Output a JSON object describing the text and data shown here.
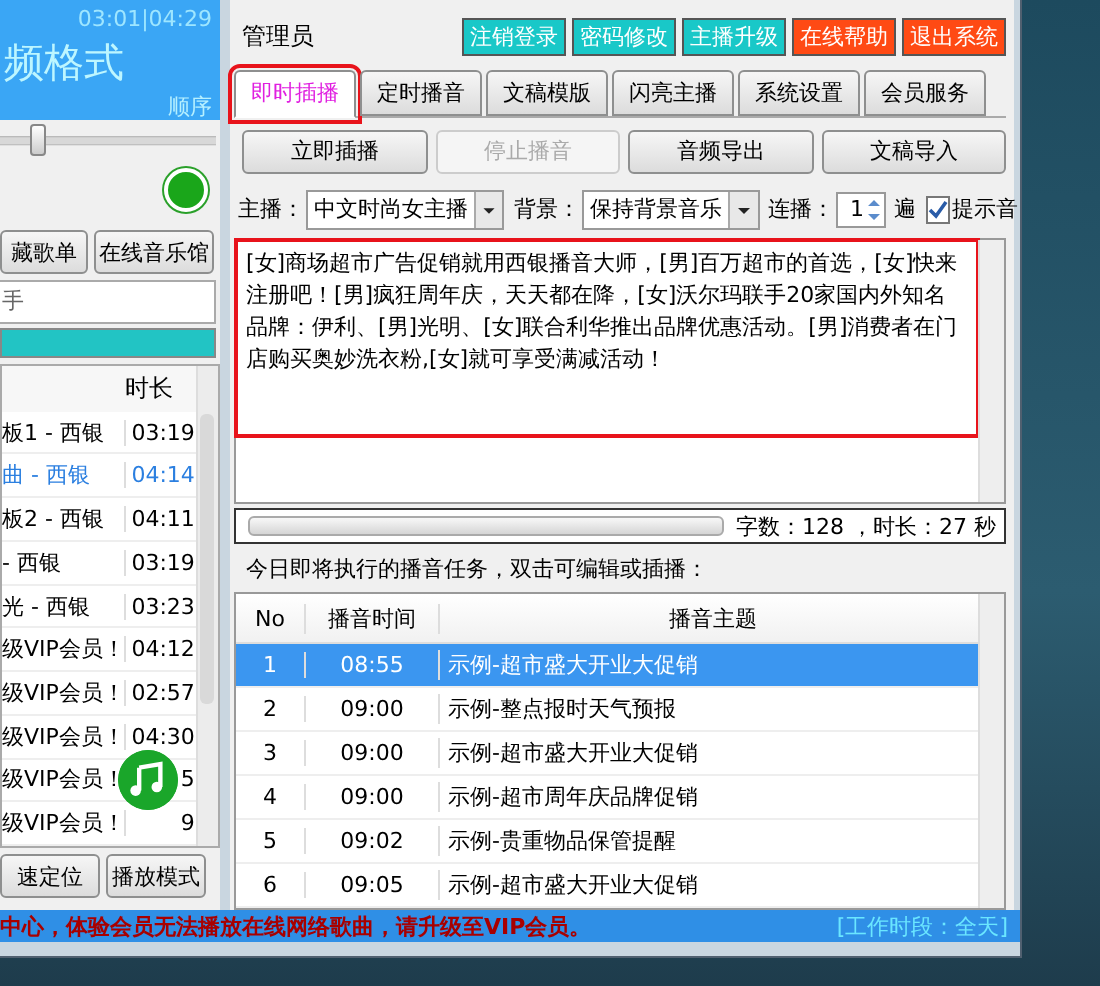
{
  "player": {
    "time": "03:01|04:29",
    "title": "频格式",
    "mode": "顺序",
    "volume": {
      "level": 0.15
    },
    "online": true
  },
  "library_buttons": [
    "藏歌单",
    "在线音乐馆"
  ],
  "search": {
    "value": "手"
  },
  "playlist": {
    "columns": [
      "时长"
    ],
    "rows": [
      {
        "title": "板1 - 西银",
        "duration": "03:19",
        "playing": false
      },
      {
        "title": "曲 - 西银",
        "duration": "04:14",
        "playing": true
      },
      {
        "title": "板2 - 西银",
        "duration": "04:11",
        "playing": false
      },
      {
        "title": "- 西银",
        "duration": "03:19",
        "playing": false
      },
      {
        "title": "光 - 西银",
        "duration": "03:23",
        "playing": false
      },
      {
        "title": "级VIP会员！",
        "duration": "04:12",
        "playing": false
      },
      {
        "title": "级VIP会员！",
        "duration": "02:57",
        "playing": false
      },
      {
        "title": "级VIP会员！",
        "duration": "04:30",
        "playing": false
      },
      {
        "title": "级VIP会员！",
        "duration": "5",
        "playing": false
      },
      {
        "title": "级VIP会员！",
        "duration": "9",
        "playing": false
      }
    ]
  },
  "playlist_buttons": [
    "速定位",
    "播放模式"
  ],
  "user": "管理员",
  "top_buttons": [
    {
      "label": "注销登录",
      "color": "#19c8c8"
    },
    {
      "label": "密码修改",
      "color": "#19c8c8"
    },
    {
      "label": "主播升级",
      "color": "#19c8c8"
    },
    {
      "label": "在线帮助",
      "color": "#ff4a14"
    },
    {
      "label": "退出系统",
      "color": "#ff4a14"
    }
  ],
  "tabs": [
    {
      "label": "即时插播",
      "selected": true,
      "highlighted": true
    },
    {
      "label": "定时播音",
      "selected": false,
      "highlighted": false
    },
    {
      "label": "文稿模版",
      "selected": false,
      "highlighted": false
    },
    {
      "label": "闪亮主播",
      "selected": false,
      "highlighted": false
    },
    {
      "label": "系统设置",
      "selected": false,
      "highlighted": false
    },
    {
      "label": "会员服务",
      "selected": false,
      "highlighted": false
    }
  ],
  "actions": [
    {
      "label": "立即插播",
      "disabled": false
    },
    {
      "label": "停止播音",
      "disabled": true
    },
    {
      "label": "音频导出",
      "disabled": false
    },
    {
      "label": "文稿导入",
      "disabled": false
    }
  ],
  "options": {
    "host_label": "主播：",
    "host": "中文时尚女主播",
    "bg_label": "背景：",
    "bg": "保持背景音乐",
    "repeat_label": "连播：",
    "repeat": "1",
    "repeat_unit": "遍",
    "chime": {
      "label": "提示音",
      "checked": true
    }
  },
  "script": {
    "text": "[女]商场超市广告促销就用西银播音大师，[男]百万超市的首选，[女]快来注册吧！[男]疯狂周年庆，天天都在降，[女]沃尔玛联手20家国内外知名品牌：伊利、[男]光明、[女]联合利华推出品牌优惠活动。[男]消费者在门店购买奥妙洗衣粉,[女]就可享受满减活动！",
    "highlighted": true
  },
  "stats": "字数：128 ，时长：27 秒",
  "tasks": {
    "caption": "今日即将执行的播音任务，双击可编辑或插播：",
    "columns": [
      "No",
      "播音时间",
      "播音主题"
    ],
    "rows": [
      {
        "no": "1",
        "time": "08:55",
        "topic": "示例-超市盛大开业大促销",
        "selected": true
      },
      {
        "no": "2",
        "time": "09:00",
        "topic": "示例-整点报时天气预报",
        "selected": false
      },
      {
        "no": "3",
        "time": "09:00",
        "topic": "示例-超市盛大开业大促销",
        "selected": false
      },
      {
        "no": "4",
        "time": "09:00",
        "topic": "示例-超市周年庆品牌促销",
        "selected": false
      },
      {
        "no": "5",
        "time": "09:02",
        "topic": "示例-贵重物品保管提醒",
        "selected": false
      },
      {
        "no": "6",
        "time": "09:05",
        "topic": "示例-超市盛大开业大促销",
        "selected": false
      }
    ]
  },
  "status": {
    "message": "中心，体验会员无法播放在线网络歌曲，请升级至VIP会员。",
    "period": "[工作时段：全天]"
  }
}
